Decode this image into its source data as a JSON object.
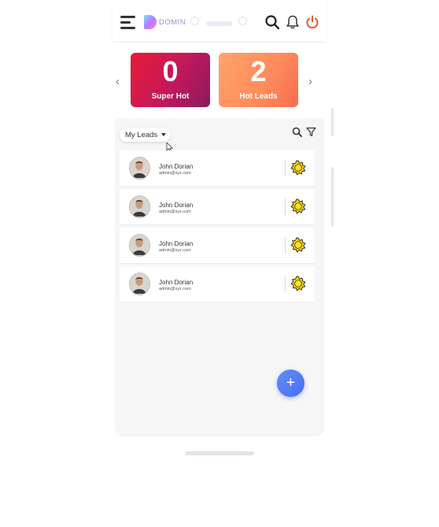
{
  "app": {
    "logo_text": "DOMIN",
    "icons": [
      "menu-icon",
      "search-icon",
      "bell-icon",
      "power-icon"
    ],
    "colors": {
      "power": "#e7592b",
      "fab": "#4a6ef0",
      "badge": "#f5d000"
    }
  },
  "stats": [
    {
      "value": "0",
      "label": "Super Hot"
    },
    {
      "value": "2",
      "label": "Hot Leads"
    }
  ],
  "filter": {
    "selected": "My Leads"
  },
  "leads": [
    {
      "name": "John Dorian",
      "email": "admin@xyz.com"
    },
    {
      "name": "John Dorian",
      "email": "admin@xyz.com"
    },
    {
      "name": "John Dorian",
      "email": "admin@xyz.com"
    },
    {
      "name": "John Dorian",
      "email": "admin@xyz.com"
    }
  ],
  "fab": {
    "label": "+"
  }
}
